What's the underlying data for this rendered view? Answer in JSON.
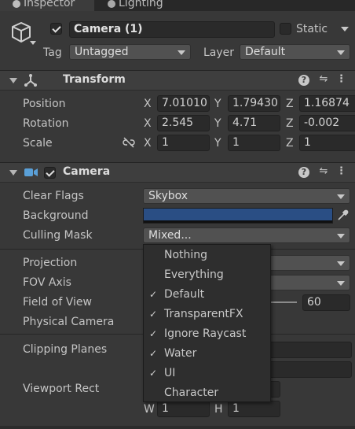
{
  "tabs": [
    {
      "label": "Inspector",
      "active": true
    },
    {
      "label": "Lighting",
      "active": false
    }
  ],
  "object": {
    "enabled": true,
    "name": "Camera (1)",
    "static_label": "Static",
    "static_checked": false,
    "tag_label": "Tag",
    "tag_value": "Untagged",
    "layer_label": "Layer",
    "layer_value": "Default"
  },
  "transform": {
    "title": "Transform",
    "rows": [
      {
        "label": "Position",
        "x": "7.01010",
        "y": "1.79430",
        "z": "1.16874"
      },
      {
        "label": "Rotation",
        "x": "2.545",
        "y": "4.71",
        "z": "-0.002"
      },
      {
        "label": "Scale",
        "x": "1",
        "y": "1",
        "z": "1"
      }
    ]
  },
  "camera": {
    "title": "Camera",
    "enabled": true,
    "clear_flags": {
      "label": "Clear Flags",
      "value": "Skybox"
    },
    "background": {
      "label": "Background",
      "color": "#2a4e84"
    },
    "culling_mask": {
      "label": "Culling Mask",
      "value": "Mixed..."
    },
    "projection": {
      "label": "Projection"
    },
    "fov_axis": {
      "label": "FOV Axis"
    },
    "field_of_view": {
      "label": "Field of View",
      "value": "60"
    },
    "physical_camera": {
      "label": "Physical Camera"
    },
    "clipping_planes": {
      "label": "Clipping Planes"
    },
    "viewport_rect": {
      "label": "Viewport Rect",
      "w_label": "W",
      "w": "1",
      "h_label": "H",
      "h": "1"
    }
  },
  "axis": {
    "x": "X",
    "y": "Y",
    "z": "Z"
  },
  "culling_menu": [
    {
      "label": "Nothing",
      "checked": false
    },
    {
      "label": "Everything",
      "checked": false
    },
    {
      "label": "Default",
      "checked": true
    },
    {
      "label": "TransparentFX",
      "checked": true
    },
    {
      "label": "Ignore Raycast",
      "checked": true
    },
    {
      "label": "Water",
      "checked": true
    },
    {
      "label": "UI",
      "checked": true
    },
    {
      "label": "Character",
      "checked": false
    }
  ],
  "icons": {
    "help": "question-icon",
    "presets": "sliders-icon",
    "menu": "kebab-icon",
    "check": "✓"
  }
}
